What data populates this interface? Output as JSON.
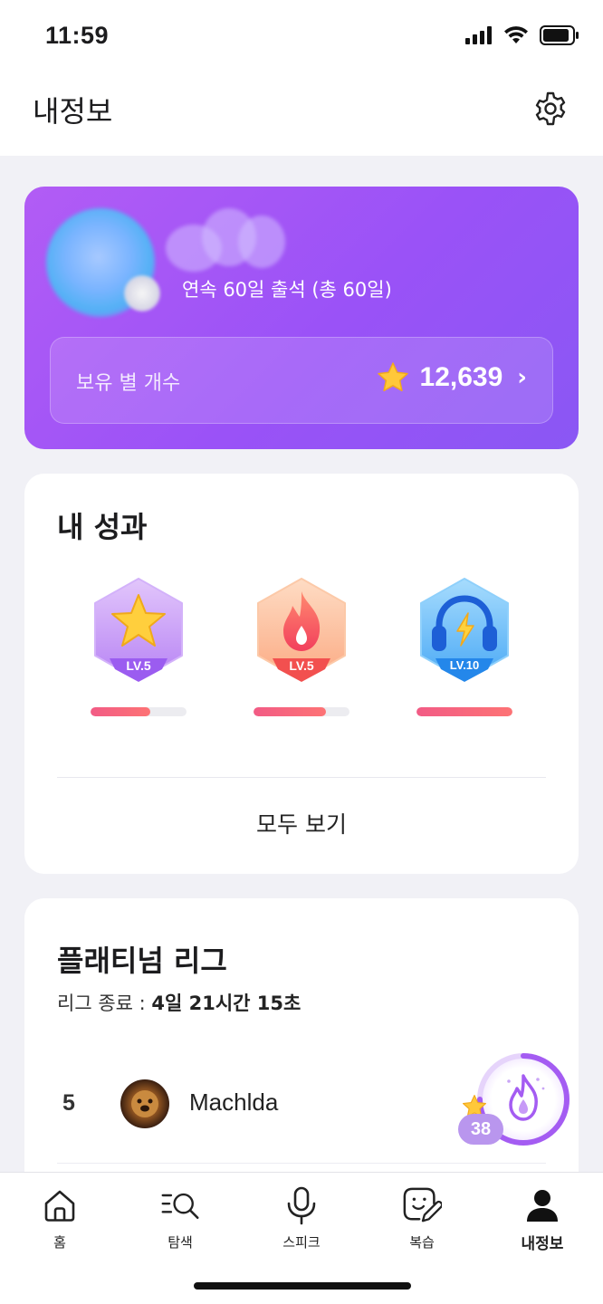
{
  "status_bar": {
    "time": "11:59"
  },
  "header": {
    "title": "내정보",
    "settings_icon": "gear-icon"
  },
  "profile": {
    "streak_text": "연속 60일 출석 (총 60일)",
    "stars_label": "보유 별 개수",
    "stars_count": "12,639",
    "chevron": "›"
  },
  "achievements": {
    "title": "내 성과",
    "badges": [
      {
        "icon": "star-badge-icon",
        "level": "LV.5",
        "progress": 0.62,
        "color": "#c8a3f6"
      },
      {
        "icon": "fire-badge-icon",
        "level": "LV.5",
        "progress": 0.75,
        "color": "#fbb08a"
      },
      {
        "icon": "headphones-badge-icon",
        "level": "LV.10",
        "progress": 1.0,
        "color": "#6bbdf8"
      }
    ],
    "view_all": "모두 보기"
  },
  "league": {
    "title": "플래티넘 리그",
    "timer_prefix": "리그 종료 : ",
    "timer_value": "4일 21시간 15초",
    "rows": [
      {
        "rank": "5",
        "name": "Machlda"
      }
    ]
  },
  "streak_widget": {
    "count": "38"
  },
  "tabs": [
    {
      "label": "홈",
      "icon": "home-icon"
    },
    {
      "label": "탐색",
      "icon": "search-list-icon"
    },
    {
      "label": "스피크",
      "icon": "microphone-icon"
    },
    {
      "label": "복습",
      "icon": "review-face-icon"
    },
    {
      "label": "내정보",
      "icon": "person-icon",
      "active": true
    }
  ],
  "colors": {
    "accent_purple": "#9a52f7",
    "progress_pink": "#f5617f"
  }
}
